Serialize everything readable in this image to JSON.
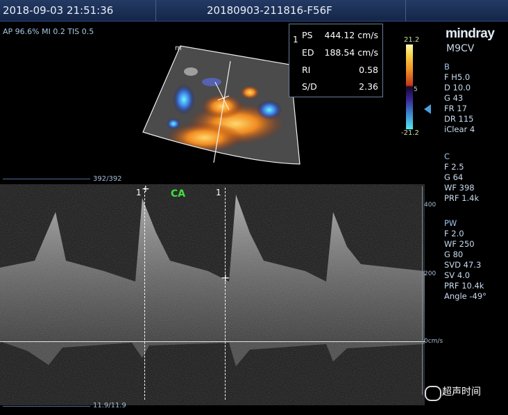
{
  "header": {
    "datetime": "2018-09-03 21:51:36",
    "patient_id": "20180903-211816-F56F"
  },
  "acoustic": "AP 96.6%  MI 0.2  TIS 0.5",
  "brand": "mindray",
  "probe": "M9CV",
  "measurements": {
    "index": "1",
    "rows": [
      {
        "label": "PS",
        "value": "444.12 cm/s"
      },
      {
        "label": "ED",
        "value": "188.54 cm/s"
      },
      {
        "label": "RI",
        "value": "0.58"
      },
      {
        "label": "S/D",
        "value": "2.36"
      }
    ]
  },
  "color_scale": {
    "top": "21.2",
    "bottom": "-21.2",
    "mid": "5"
  },
  "modes": {
    "b": {
      "title": "B",
      "lines": [
        "F H5.0",
        "D 10.0",
        "G 43",
        "FR 17",
        "DR 115",
        "iClear 4"
      ]
    },
    "c": {
      "title": "C",
      "lines": [
        "F 2.5",
        "G 64",
        "WF 398",
        "PRF 1.4k"
      ]
    },
    "pw": {
      "title": "PW",
      "lines": [
        "F 2.0",
        "WF 250",
        "G 80",
        "SVD 47.3",
        "SV 4.0",
        "PRF 10.4k",
        "Angle -49°"
      ]
    }
  },
  "spectrum": {
    "label": "CA",
    "cursor_label_left": "1",
    "cursor_label_right": "1",
    "scale_ticks": [
      "400",
      "200",
      "0cm/s"
    ],
    "frame_top": "392/392",
    "frame_bottom": "11.9/11.9"
  },
  "watermark": "超声时间"
}
